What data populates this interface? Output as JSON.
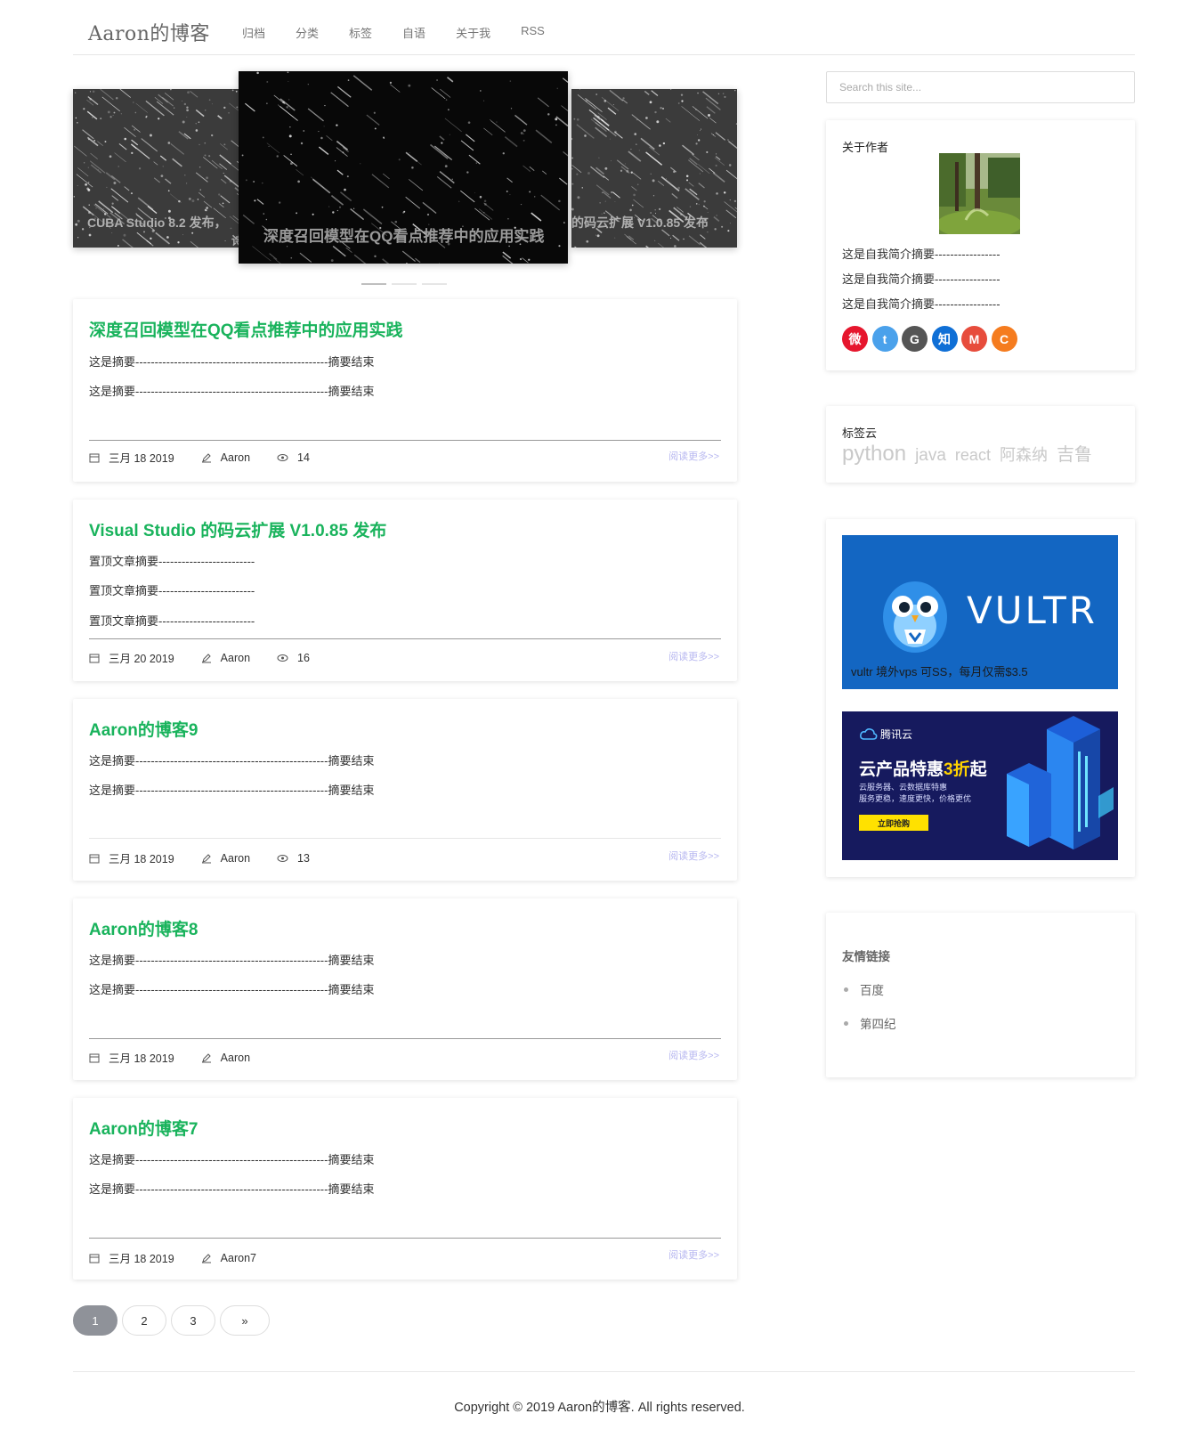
{
  "header": {
    "brand": "Aaron的博客",
    "nav": [
      "归档",
      "分类",
      "标签",
      "自语",
      "关于我",
      "RSS"
    ]
  },
  "carousel": {
    "slides": [
      {
        "caption": "CUBA Studio 8.2 发布，",
        "caption_tail": "诗"
      },
      {
        "caption": "深度召回模型在QQ看点推荐中的应用实践"
      },
      {
        "caption": "的码云扩展 V1.0.85 发布"
      }
    ],
    "active_index": 0,
    "dot_count": 3
  },
  "posts": [
    {
      "title": "深度召回模型在QQ看点推荐中的应用实践",
      "excerpt": [
        "这是摘要--------------------------------------------------摘要结束",
        "这是摘要--------------------------------------------------摘要结束"
      ],
      "date": "三月 18 2019",
      "author": "Aaron",
      "views": "14",
      "read_more": "阅读更多>>"
    },
    {
      "title": "Visual Studio 的码云扩展 V1.0.85 发布",
      "excerpt": [
        "置顶文章摘要-------------------------",
        "置顶文章摘要-------------------------",
        "置顶文章摘要-------------------------"
      ],
      "date": "三月 20 2019",
      "author": "Aaron",
      "views": "16",
      "read_more": "阅读更多>>"
    },
    {
      "title": "Aaron的博客9",
      "excerpt": [
        "这是摘要--------------------------------------------------摘要结束",
        "这是摘要--------------------------------------------------摘要结束"
      ],
      "date": "三月 18 2019",
      "author": "Aaron",
      "views": "13",
      "read_more": "阅读更多>>"
    },
    {
      "title": "Aaron的博客8",
      "excerpt": [
        "这是摘要--------------------------------------------------摘要结束",
        "这是摘要--------------------------------------------------摘要结束"
      ],
      "date": "三月 18 2019",
      "author": "Aaron",
      "views": "",
      "read_more": "阅读更多>>"
    },
    {
      "title": "Aaron的博客7",
      "excerpt": [
        "这是摘要--------------------------------------------------摘要结束",
        "这是摘要--------------------------------------------------摘要结束"
      ],
      "date": "三月 18 2019",
      "author": "Aaron7",
      "views": "",
      "read_more": "阅读更多>>"
    }
  ],
  "pagination": {
    "pages": [
      "1",
      "2",
      "3"
    ],
    "next": "»",
    "current": "1"
  },
  "sidebar": {
    "search_placeholder": "Search this site...",
    "about": {
      "title": "关于作者",
      "bio": [
        "这是自我简介摘要-----------------",
        "这是自我简介摘要-----------------",
        "这是自我简介摘要-----------------"
      ],
      "socials": [
        {
          "icon": "weibo-icon",
          "glyph": "微",
          "color": "#e6162d"
        },
        {
          "icon": "twitter-icon",
          "glyph": "t",
          "color": "#4aa1eb"
        },
        {
          "icon": "github-icon",
          "glyph": "G",
          "color": "#555555"
        },
        {
          "icon": "zhihu-icon",
          "glyph": "知",
          "color": "#0f6fd6"
        },
        {
          "icon": "gmail-icon",
          "glyph": "M",
          "color": "#e74c3c"
        },
        {
          "icon": "csdn-icon",
          "glyph": "C",
          "color": "#f57c1f"
        }
      ]
    },
    "tag_cloud": {
      "title": "标签云",
      "tags": [
        "python",
        "java",
        "react",
        "阿森纳",
        "吉鲁"
      ]
    },
    "ads": {
      "vultr": {
        "brand": "VULTR",
        "text": "vultr 境外vps 可SS，每月仅需$3.5",
        "color": "#1366c2"
      },
      "tencent": {
        "logo": "腾讯云",
        "headline_pre": "云产品特惠",
        "headline_highlight": "3折",
        "headline_post": "起",
        "line1": "云服务器、云数据库特惠",
        "line2": "服务更稳，速度更快，价格更优",
        "cta": "立即抢购"
      }
    },
    "links": {
      "title": "友情链接",
      "items": [
        "百度",
        "第四纪"
      ]
    }
  },
  "footer": {
    "copyright": "Copyright © 2019 Aaron的博客. All rights reserved."
  }
}
